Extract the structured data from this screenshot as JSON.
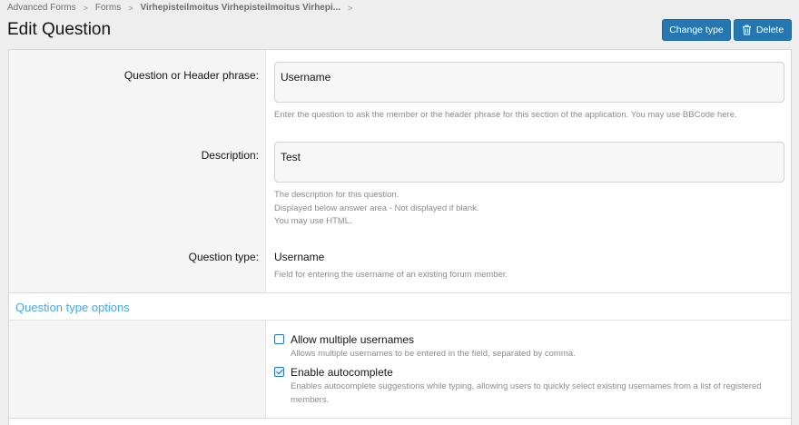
{
  "breadcrumb": {
    "items": [
      "Advanced Forms",
      "Forms",
      "Virhepisteilmoitus Virhepisteilmoitus Virhepi..."
    ],
    "separator": ">"
  },
  "page": {
    "title": "Edit Question"
  },
  "toolbar": {
    "change_type_label": "Change type",
    "delete_label": "Delete"
  },
  "form": {
    "question": {
      "label": "Question or Header phrase:",
      "value": "Username",
      "hint": "Enter the question to ask the member or the header phrase for this section of the application. You may use BBCode here."
    },
    "description": {
      "label": "Description:",
      "value": "Test",
      "hint_lines": [
        "The description for this question.",
        "Displayed below answer area - Not displayed if blank.",
        "You may use HTML."
      ]
    },
    "question_type": {
      "label": "Question type:",
      "value": "Username",
      "hint": "Field for entering the username of an existing forum member."
    }
  },
  "options_section": {
    "title": "Question type options",
    "allow_multiple": {
      "label": "Allow multiple usernames",
      "hint": "Allows multiple usernames to be entered in the field, separated by comma.",
      "checked": false
    },
    "autocomplete": {
      "label": "Enable autocomplete",
      "hint": "Enables autocomplete suggestions while typing, allowing users to quickly select existing usernames from a list of registered members.",
      "checked": true
    }
  },
  "colors": {
    "accent": "#2577b1",
    "section_title": "#47a7eb"
  }
}
